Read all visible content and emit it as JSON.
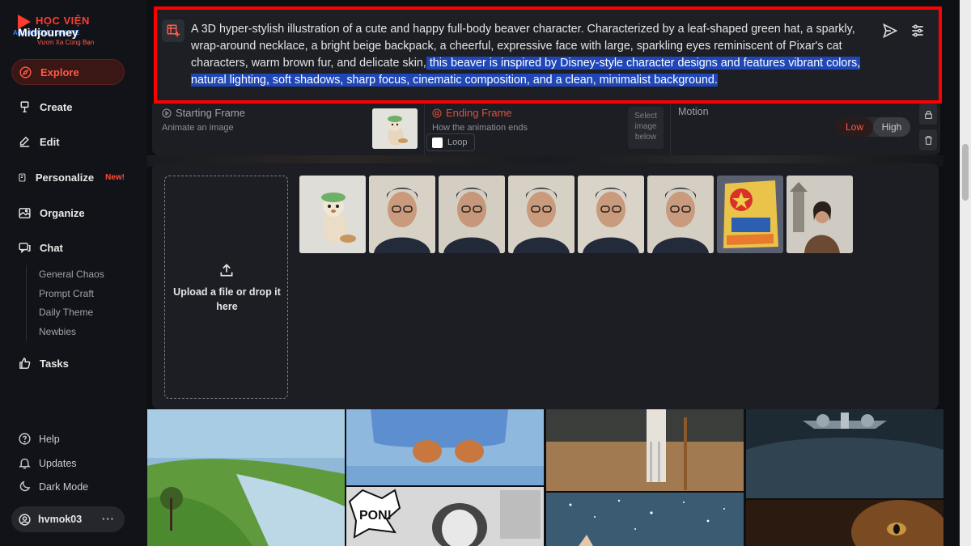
{
  "logo": {
    "brand_top": "HỌC VIỆN",
    "brand_main": "Midjourney",
    "tagline": "Vươn Xa Cùng Bạn",
    "watermark": "ANG HUONG ONLINE"
  },
  "sidebar": {
    "items": [
      {
        "label": "Explore",
        "icon": "compass-icon",
        "active": true
      },
      {
        "label": "Create",
        "icon": "brush-icon"
      },
      {
        "label": "Edit",
        "icon": "edit-icon"
      },
      {
        "label": "Personalize",
        "icon": "personalize-icon",
        "badge": "New!"
      },
      {
        "label": "Organize",
        "icon": "image-icon"
      },
      {
        "label": "Chat",
        "icon": "chat-icon"
      },
      {
        "label": "Tasks",
        "icon": "thumbs-up-icon"
      }
    ],
    "chat_rooms": [
      "General Chaos",
      "Prompt Craft",
      "Daily Theme",
      "Newbies"
    ],
    "footer": [
      {
        "label": "Help",
        "icon": "help-icon"
      },
      {
        "label": "Updates",
        "icon": "bell-icon"
      },
      {
        "label": "Dark Mode",
        "icon": "moon-icon"
      }
    ],
    "user": {
      "name": "hvmok03",
      "more": "···"
    }
  },
  "prompt": {
    "text_plain": "A 3D hyper-stylish illustration of a cute and happy full-body beaver character. Characterized by a leaf-shaped green hat, a sparkly, wrap-around necklace, a bright beige backpack, a cheerful, expressive face with large, sparkling eyes reminiscent of Pixar's cat characters, warm brown fur, and delicate skin,",
    "text_selected": " this beaver is inspired by Disney-style character designs and features vibrant colors, natural lighting, soft shadows, sharp focus, cinematic composition, and a clean, minimalist background.",
    "accent_color": "#ff0000",
    "selection_color": "#1f47b8"
  },
  "frames": {
    "starting_title": "Starting Frame",
    "starting_sub": "Animate an image",
    "ending_title": "Ending Frame",
    "ending_sub": "How the animation ends",
    "loop_label": "Loop",
    "select_below": "Select image below",
    "motion_label": "Motion",
    "motion_low": "Low",
    "motion_high": "High",
    "motion_selected": "Low"
  },
  "upload": {
    "label": "Upload a file or drop it here"
  }
}
